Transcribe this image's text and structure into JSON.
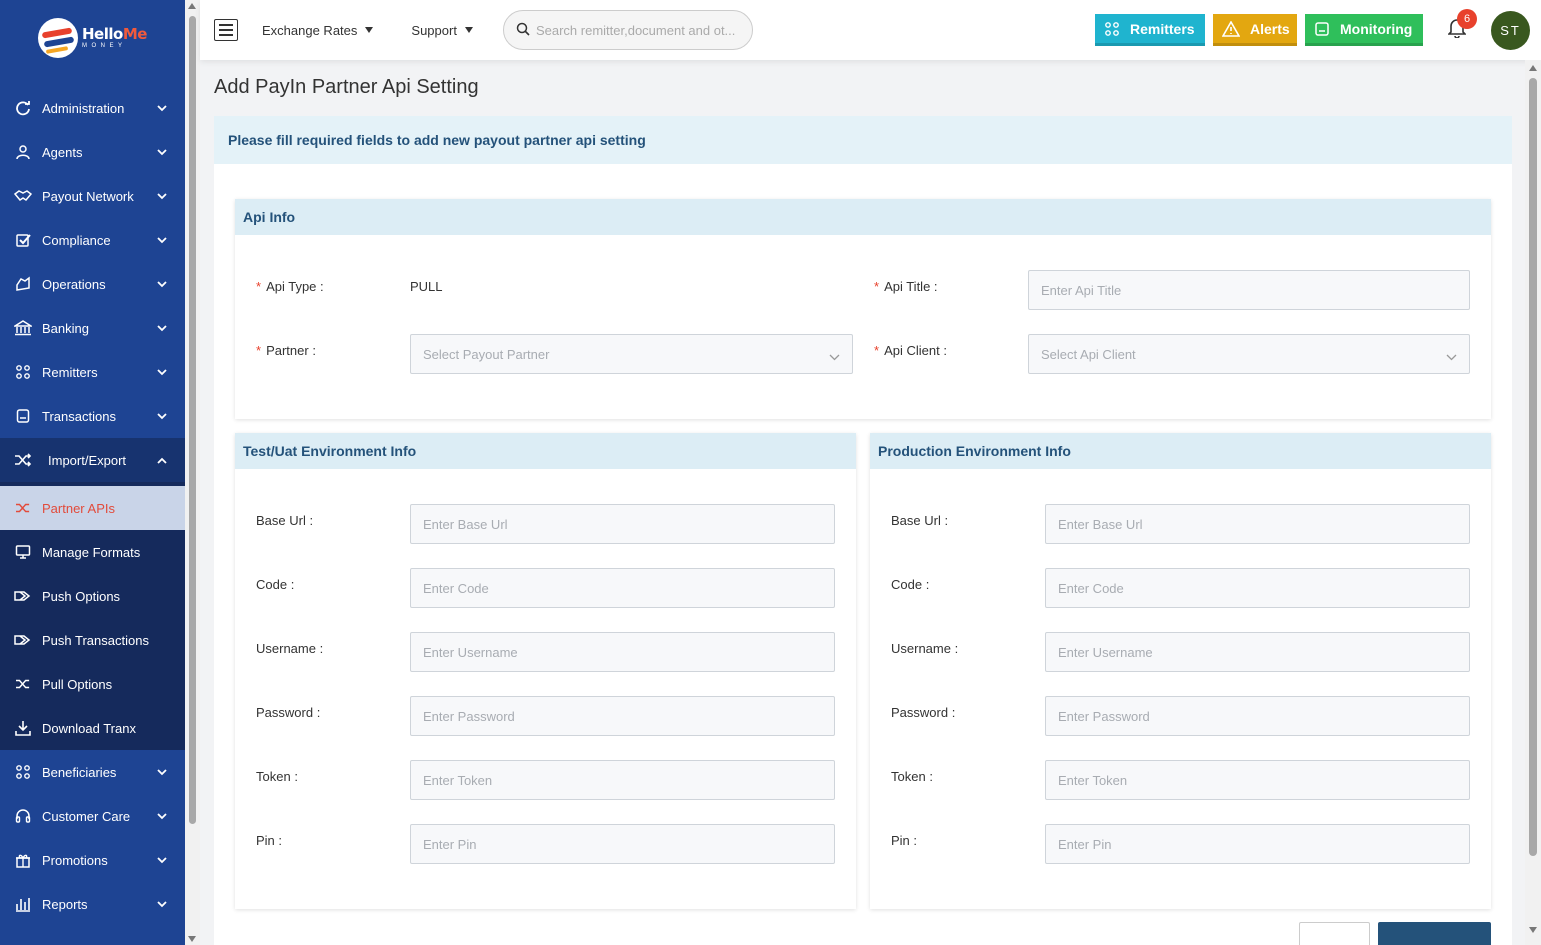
{
  "brand": {
    "logo_main": "Hello",
    "logo_accent": "Me",
    "logo_sub": "MONEY"
  },
  "sidebar": {
    "items": [
      {
        "label": "Administration",
        "icon": "refresh-icon"
      },
      {
        "label": "Agents",
        "icon": "user-icon"
      },
      {
        "label": "Payout Network",
        "icon": "handshake-icon"
      },
      {
        "label": "Compliance",
        "icon": "check-square-icon"
      },
      {
        "label": "Operations",
        "icon": "operations-icon"
      },
      {
        "label": "Banking",
        "icon": "bank-icon"
      },
      {
        "label": "Remitters",
        "icon": "network-icon"
      },
      {
        "label": "Transactions",
        "icon": "receipt-icon"
      },
      {
        "label": "Import/Export",
        "icon": "shuffle-icon"
      }
    ],
    "sub_items": [
      {
        "label": "Partner APIs",
        "icon": "shuffle-icon"
      },
      {
        "label": "Manage Formats",
        "icon": "monitor-icon"
      },
      {
        "label": "Push Options",
        "icon": "push-icon"
      },
      {
        "label": "Push Transactions",
        "icon": "push-icon"
      },
      {
        "label": "Pull Options",
        "icon": "shuffle-icon"
      },
      {
        "label": "Download Tranx",
        "icon": "download-icon"
      }
    ],
    "bottom_items": [
      {
        "label": "Beneficiaries",
        "icon": "network-icon"
      },
      {
        "label": "Customer Care",
        "icon": "headset-icon"
      },
      {
        "label": "Promotions",
        "icon": "gift-icon"
      },
      {
        "label": "Reports",
        "icon": "bar-chart-icon"
      }
    ]
  },
  "header": {
    "menus": [
      "Exchange Rates",
      "Support"
    ],
    "search_placeholder": "Search remitter,document and ot...",
    "buttons": [
      {
        "label": "Remitters",
        "color": "#1fb4cf"
      },
      {
        "label": "Alerts",
        "color": "#e3a710"
      },
      {
        "label": "Monitoring",
        "color": "#2fbf5b"
      }
    ],
    "notification_count": "6",
    "avatar_initials": "ST"
  },
  "page": {
    "title": "Add PayIn Partner Api Setting",
    "notice": "Please fill required fields to add new payout partner api setting"
  },
  "api_info": {
    "title": "Api Info",
    "api_type_label": "Api Type",
    "api_type_value": "PULL",
    "api_title_label": "Api Title",
    "api_title_placeholder": "Enter Api Title",
    "partner_label": "Partner",
    "partner_placeholder": "Select Payout Partner",
    "api_client_label": "Api Client",
    "api_client_placeholder": "Select Api Client"
  },
  "test_env": {
    "title": "Test/Uat Environment Info",
    "fields": [
      {
        "label": "Base Url",
        "placeholder": "Enter Base Url"
      },
      {
        "label": "Code",
        "placeholder": "Enter Code"
      },
      {
        "label": "Username",
        "placeholder": "Enter Username"
      },
      {
        "label": "Password",
        "placeholder": "Enter Password"
      },
      {
        "label": "Token",
        "placeholder": "Enter Token"
      },
      {
        "label": "Pin",
        "placeholder": "Enter Pin"
      }
    ]
  },
  "prod_env": {
    "title": "Production Environment Info",
    "fields": [
      {
        "label": "Base Url",
        "placeholder": "Enter Base Url"
      },
      {
        "label": "Code",
        "placeholder": "Enter Code"
      },
      {
        "label": "Username",
        "placeholder": "Enter Username"
      },
      {
        "label": "Password",
        "placeholder": "Enter Password"
      },
      {
        "label": "Token",
        "placeholder": "Enter Token"
      },
      {
        "label": "Pin",
        "placeholder": "Enter Pin"
      }
    ]
  }
}
